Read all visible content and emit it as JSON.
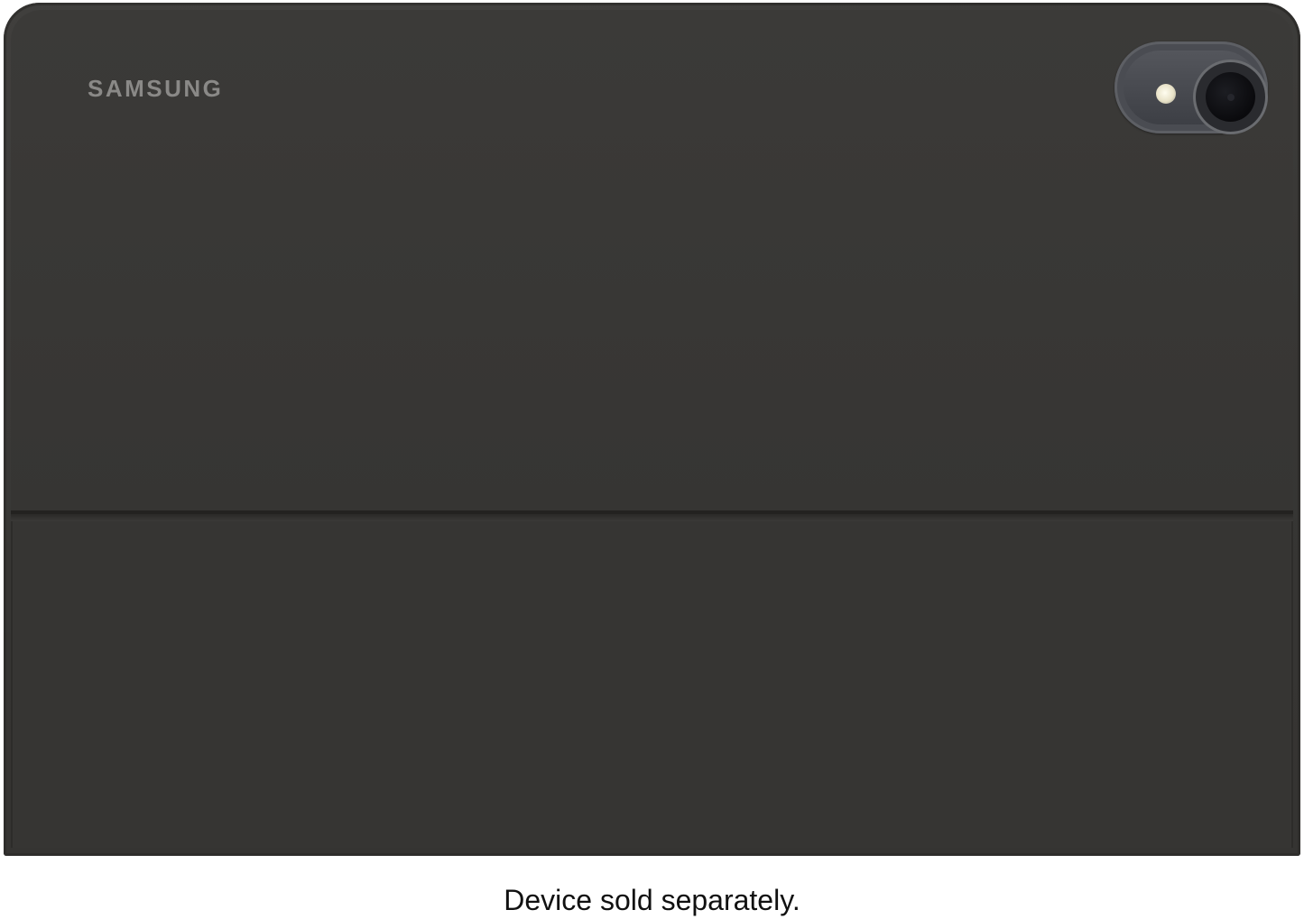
{
  "product": {
    "brand": "SAMSUNG",
    "caption": "Device sold separately.",
    "case_color": "#363533",
    "camera_ring_color": "#4a4c52"
  }
}
